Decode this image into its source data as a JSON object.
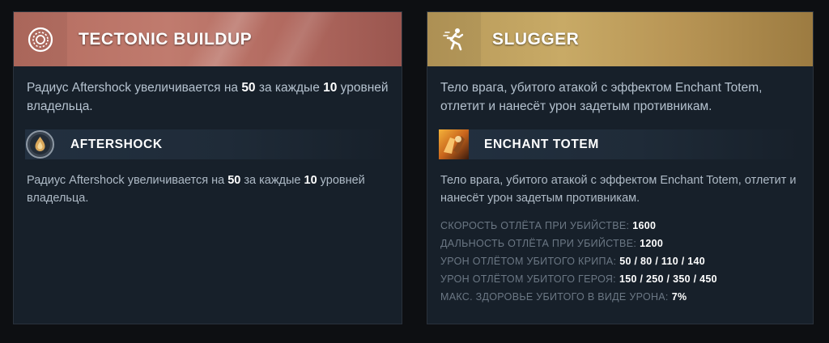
{
  "left_card": {
    "title": "TECTONIC BUILDUP",
    "icon": "ring-icon",
    "desc": {
      "t1": "Радиус Aftershock увеличивается на ",
      "v1": "50",
      "t2": " за каждые ",
      "v2": "10",
      "t3": " уровней владельца."
    },
    "ability": {
      "name": "AFTERSHOCK",
      "icon": "aftershock-icon",
      "desc": {
        "t1": "Радиус Aftershock увеличивается на ",
        "v1": "50",
        "t2": " за каждые ",
        "v2": "10",
        "t3": " уровней владельца."
      }
    }
  },
  "right_card": {
    "title": "SLUGGER",
    "icon": "running-figure-icon",
    "desc": "Тело врага, убитого атакой с эффектом Enchant Totem, отлетит и нанесёт урон задетым противникам.",
    "ability": {
      "name": "ENCHANT TOTEM",
      "icon": "enchant-totem-icon",
      "desc": "Тело врага, убитого атакой с эффектом Enchant Totem, отлетит и нанесёт урон задетым противникам."
    },
    "stats": [
      {
        "label": "СКОРОСТЬ ОТЛЁТА ПРИ УБИЙСТВЕ:",
        "value": "1600"
      },
      {
        "label": "ДАЛЬНОСТЬ ОТЛЁТА ПРИ УБИЙСТВЕ:",
        "value": "1200"
      },
      {
        "label": "УРОН ОТЛЁТОМ УБИТОГО КРИПА:",
        "value": "50 / 80 / 110 / 140"
      },
      {
        "label": "УРОН ОТЛЁТОМ УБИТОГО ГЕРОЯ:",
        "value": "150 / 250 / 350 / 450"
      },
      {
        "label": "МАКС. ЗДОРОВЬЕ УБИТОГО В ВИДЕ УРОНА:",
        "value": "7%"
      }
    ]
  },
  "colors": {
    "background": "#0d0f12",
    "card": "#17202a",
    "left_header": "#b56d60",
    "right_header": "#c8aa66",
    "text": "#b5c2cf",
    "stat_label": "#6b7784"
  }
}
